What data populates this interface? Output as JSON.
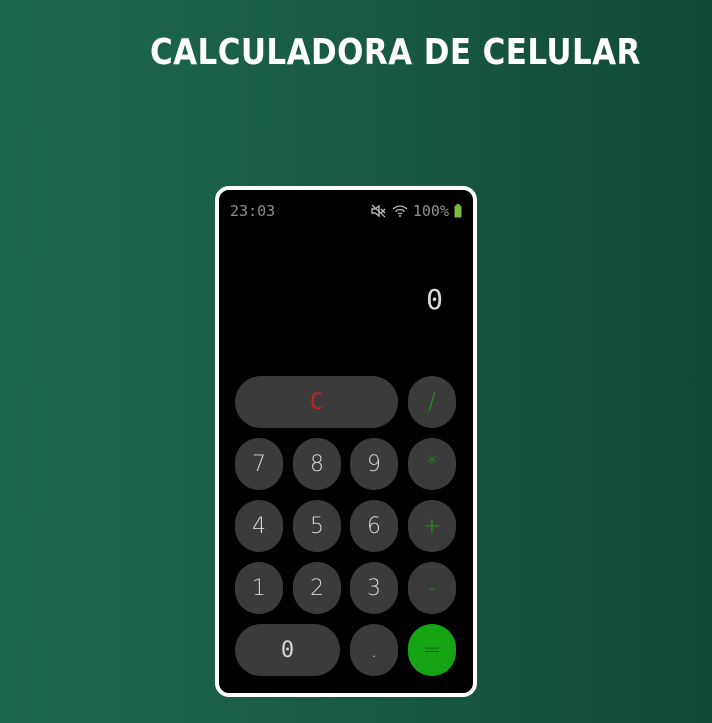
{
  "page": {
    "title": "CALCULADORA DE CELULAR"
  },
  "status_bar": {
    "time": "23:03",
    "battery_text": "100%",
    "icons": [
      "mute-icon",
      "wifi-icon",
      "battery-icon"
    ],
    "battery_color": "#7dbb3f"
  },
  "display": {
    "value": "0"
  },
  "keys": {
    "clear": "C",
    "divide": "/",
    "seven": "7",
    "eight": "8",
    "nine": "9",
    "multiply": "*",
    "four": "4",
    "five": "5",
    "six": "6",
    "plus": "+",
    "one": "1",
    "two": "2",
    "three": "3",
    "minus": "-",
    "zero": "0",
    "decimal": ".",
    "equals": "="
  },
  "colors": {
    "background_start": "#1d694e",
    "background_end": "#114a37",
    "key_background": "#3b3b3b",
    "operator_color": "#1f9a1b",
    "clear_color": "#d11d1d",
    "equals_background": "#15a413"
  }
}
